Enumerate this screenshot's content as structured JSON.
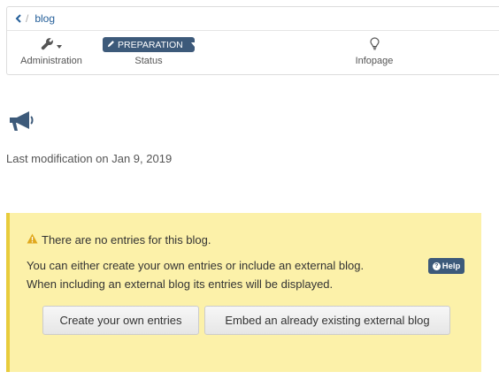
{
  "breadcrumb": {
    "back_icon": "chevron-left-icon",
    "separator": "/",
    "current": "blog"
  },
  "toolbar": {
    "administration": {
      "label": "Administration",
      "icon": "wrench-icon"
    },
    "status": {
      "badge": "PREPARATION",
      "label": "Status",
      "icon": "pencil-icon"
    },
    "infopage": {
      "label": "Infopage",
      "icon": "lightbulb-icon"
    }
  },
  "blog": {
    "icon": "megaphone-icon",
    "last_modification": "Last modification on Jan 9, 2019"
  },
  "notice": {
    "title": "There are no entries for this blog.",
    "line1": "You can either create your own entries or include an external blog.",
    "line2": "When including an external blog its entries will be displayed.",
    "help_label": "Help",
    "create_button": "Create your own entries",
    "embed_button": "Embed an already existing external blog"
  },
  "colors": {
    "link": "#26609a",
    "badge": "#3d5a7a",
    "notice_bg": "#fcf1a9",
    "notice_border": "#e8cc3c",
    "warning_icon": "#e0a81c"
  }
}
